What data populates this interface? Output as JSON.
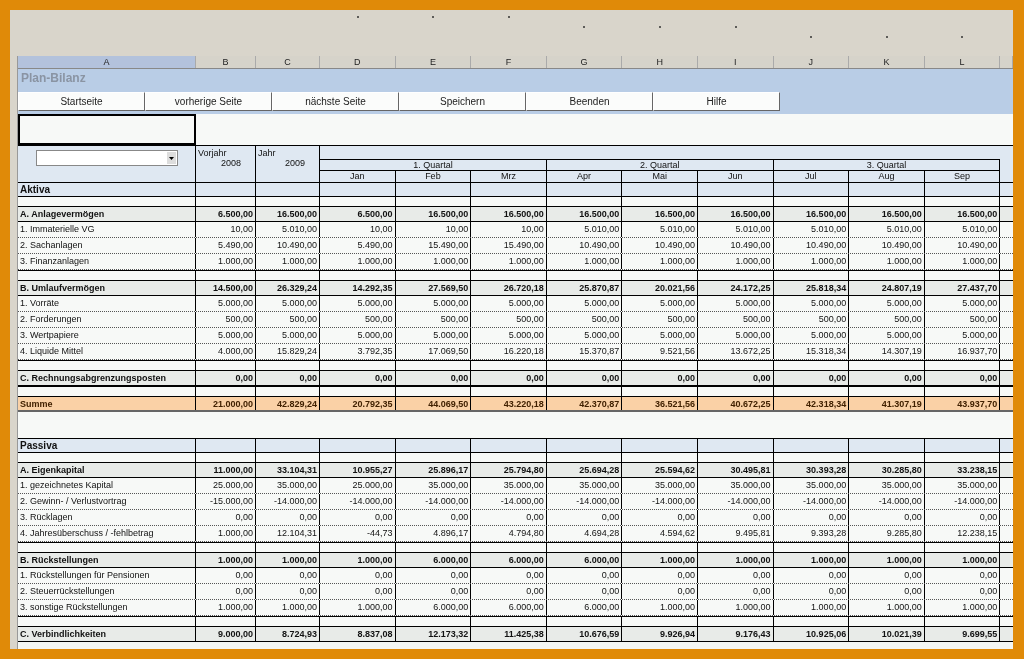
{
  "columns": [
    {
      "label": "A",
      "selected": true
    },
    {
      "label": "B",
      "selected": false
    },
    {
      "label": "C",
      "selected": false
    },
    {
      "label": "D",
      "selected": false
    },
    {
      "label": "E",
      "selected": false
    },
    {
      "label": "F",
      "selected": false
    },
    {
      "label": "G",
      "selected": false
    },
    {
      "label": "H",
      "selected": false
    },
    {
      "label": "I",
      "selected": false
    },
    {
      "label": "J",
      "selected": false
    },
    {
      "label": "K",
      "selected": false
    },
    {
      "label": "L",
      "selected": false
    }
  ],
  "title": "Plan-Bilanz",
  "buttons": [
    "Startseite",
    "vorherige Seite",
    "nächste Seite",
    "Speichern",
    "Beenden",
    "Hilfe"
  ],
  "entry_cell": {
    "selected": true
  },
  "header": {
    "prev_year_label": "Vorjahr",
    "prev_year": "2008",
    "year_label": "Jahr",
    "year": "2009",
    "quarters": [
      {
        "label": "1. Quartal",
        "months": [
          "Jan",
          "Feb",
          "Mrz"
        ]
      },
      {
        "label": "2. Quartal",
        "months": [
          "Apr",
          "Mai",
          "Jun"
        ]
      },
      {
        "label": "3. Quartal",
        "months": [
          "Jul",
          "Aug",
          "Sep"
        ]
      }
    ]
  },
  "rows": [
    {
      "kind": "section",
      "label": "Aktiva"
    },
    {
      "kind": "blank"
    },
    {
      "kind": "group",
      "label": "A. Anlagevermögen",
      "values": [
        "6.500,00",
        "16.500,00",
        "6.500,00",
        "16.500,00",
        "16.500,00",
        "16.500,00",
        "16.500,00",
        "16.500,00",
        "16.500,00",
        "16.500,00",
        "16.500,00"
      ]
    },
    {
      "kind": "item",
      "label": "1. Immaterielle VG",
      "values": [
        "10,00",
        "5.010,00",
        "10,00",
        "10,00",
        "10,00",
        "5.010,00",
        "5.010,00",
        "5.010,00",
        "5.010,00",
        "5.010,00",
        "5.010,00"
      ]
    },
    {
      "kind": "item",
      "label": "2. Sachanlagen",
      "values": [
        "5.490,00",
        "10.490,00",
        "5.490,00",
        "15.490,00",
        "15.490,00",
        "10.490,00",
        "10.490,00",
        "10.490,00",
        "10.490,00",
        "10.490,00",
        "10.490,00"
      ]
    },
    {
      "kind": "item",
      "label": "3. Finanzanlagen",
      "values": [
        "1.000,00",
        "1.000,00",
        "1.000,00",
        "1.000,00",
        "1.000,00",
        "1.000,00",
        "1.000,00",
        "1.000,00",
        "1.000,00",
        "1.000,00",
        "1.000,00"
      ]
    },
    {
      "kind": "blank"
    },
    {
      "kind": "group",
      "label": "B. Umlaufvermögen",
      "values": [
        "14.500,00",
        "26.329,24",
        "14.292,35",
        "27.569,50",
        "26.720,18",
        "25.870,87",
        "20.021,56",
        "24.172,25",
        "25.818,34",
        "24.807,19",
        "27.437,70"
      ]
    },
    {
      "kind": "item",
      "label": "1. Vorräte",
      "values": [
        "5.000,00",
        "5.000,00",
        "5.000,00",
        "5.000,00",
        "5.000,00",
        "5.000,00",
        "5.000,00",
        "5.000,00",
        "5.000,00",
        "5.000,00",
        "5.000,00"
      ]
    },
    {
      "kind": "item",
      "label": "2. Forderungen",
      "values": [
        "500,00",
        "500,00",
        "500,00",
        "500,00",
        "500,00",
        "500,00",
        "500,00",
        "500,00",
        "500,00",
        "500,00",
        "500,00"
      ]
    },
    {
      "kind": "item",
      "label": "3. Wertpapiere",
      "values": [
        "5.000,00",
        "5.000,00",
        "5.000,00",
        "5.000,00",
        "5.000,00",
        "5.000,00",
        "5.000,00",
        "5.000,00",
        "5.000,00",
        "5.000,00",
        "5.000,00"
      ]
    },
    {
      "kind": "item",
      "label": "4. Liquide Mittel",
      "values": [
        "4.000,00",
        "15.829,24",
        "3.792,35",
        "17.069,50",
        "16.220,18",
        "15.370,87",
        "9.521,56",
        "13.672,25",
        "15.318,34",
        "14.307,19",
        "16.937,70"
      ]
    },
    {
      "kind": "blank"
    },
    {
      "kind": "group",
      "label": "C. Rechnungsabgrenzungsposten",
      "values": [
        "0,00",
        "0,00",
        "0,00",
        "0,00",
        "0,00",
        "0,00",
        "0,00",
        "0,00",
        "0,00",
        "0,00",
        "0,00"
      ]
    },
    {
      "kind": "blank"
    },
    {
      "kind": "sum",
      "label": "Summe",
      "values": [
        "21.000,00",
        "42.829,24",
        "20.792,35",
        "44.069,50",
        "43.220,18",
        "42.370,87",
        "36.521,56",
        "40.672,25",
        "42.318,34",
        "41.307,19",
        "43.937,70"
      ]
    },
    {
      "kind": "gap"
    },
    {
      "kind": "section",
      "label": "Passiva"
    },
    {
      "kind": "blank"
    },
    {
      "kind": "group",
      "label": "A. Eigenkapital",
      "values": [
        "11.000,00",
        "33.104,31",
        "10.955,27",
        "25.896,17",
        "25.794,80",
        "25.694,28",
        "25.594,62",
        "30.495,81",
        "30.393,28",
        "30.285,80",
        "33.238,15"
      ]
    },
    {
      "kind": "item",
      "label": "1. gezeichnetes Kapital",
      "values": [
        "25.000,00",
        "35.000,00",
        "25.000,00",
        "35.000,00",
        "35.000,00",
        "35.000,00",
        "35.000,00",
        "35.000,00",
        "35.000,00",
        "35.000,00",
        "35.000,00"
      ]
    },
    {
      "kind": "item",
      "label": "2. Gewinn- / Verlustvortrag",
      "values": [
        "-15.000,00",
        "-14.000,00",
        "-14.000,00",
        "-14.000,00",
        "-14.000,00",
        "-14.000,00",
        "-14.000,00",
        "-14.000,00",
        "-14.000,00",
        "-14.000,00",
        "-14.000,00"
      ]
    },
    {
      "kind": "item",
      "label": "3. Rücklagen",
      "values": [
        "0,00",
        "0,00",
        "0,00",
        "0,00",
        "0,00",
        "0,00",
        "0,00",
        "0,00",
        "0,00",
        "0,00",
        "0,00"
      ]
    },
    {
      "kind": "item",
      "label": "4. Jahresüberschuss / -fehlbetrag",
      "values": [
        "1.000,00",
        "12.104,31",
        "-44,73",
        "4.896,17",
        "4.794,80",
        "4.694,28",
        "4.594,62",
        "9.495,81",
        "9.393,28",
        "9.285,80",
        "12.238,15"
      ]
    },
    {
      "kind": "blank"
    },
    {
      "kind": "group",
      "label": "B. Rückstellungen",
      "values": [
        "1.000,00",
        "1.000,00",
        "1.000,00",
        "6.000,00",
        "6.000,00",
        "6.000,00",
        "1.000,00",
        "1.000,00",
        "1.000,00",
        "1.000,00",
        "1.000,00"
      ]
    },
    {
      "kind": "item",
      "label": "1. Rückstellungen für Pensionen",
      "values": [
        "0,00",
        "0,00",
        "0,00",
        "0,00",
        "0,00",
        "0,00",
        "0,00",
        "0,00",
        "0,00",
        "0,00",
        "0,00"
      ]
    },
    {
      "kind": "item",
      "label": "2. Steuerrückstellungen",
      "values": [
        "0,00",
        "0,00",
        "0,00",
        "0,00",
        "0,00",
        "0,00",
        "0,00",
        "0,00",
        "0,00",
        "0,00",
        "0,00"
      ]
    },
    {
      "kind": "item",
      "label": "3. sonstige Rückstellungen",
      "values": [
        "1.000,00",
        "1.000,00",
        "1.000,00",
        "6.000,00",
        "6.000,00",
        "6.000,00",
        "1.000,00",
        "1.000,00",
        "1.000,00",
        "1.000,00",
        "1.000,00"
      ]
    },
    {
      "kind": "blank"
    },
    {
      "kind": "group",
      "label": "C. Verbindlichkeiten",
      "values": [
        "9.000,00",
        "8.724,93",
        "8.837,08",
        "12.173,32",
        "11.425,38",
        "10.676,59",
        "9.926,94",
        "9.176,43",
        "10.925,06",
        "10.021,39",
        "9.699,55"
      ]
    }
  ]
}
